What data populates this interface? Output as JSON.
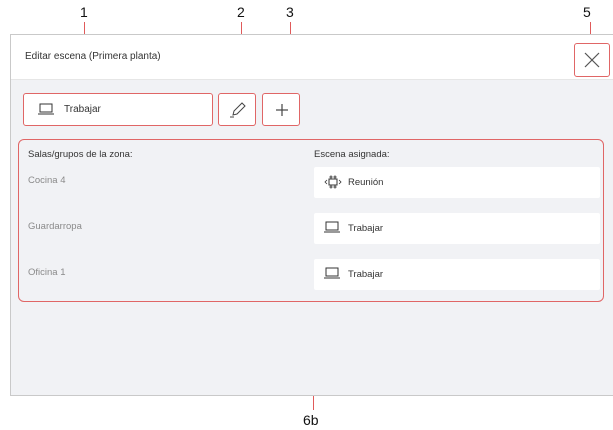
{
  "callouts": {
    "c1": "1",
    "c2": "2",
    "c3": "3",
    "c5": "5",
    "c6b": "6b"
  },
  "dialog": {
    "title": "Editar escena (Primera planta)",
    "close_icon": "close-icon"
  },
  "toolbar": {
    "scene_label": "Trabajar",
    "scene_icon": "laptop-icon",
    "edit_icon": "pencil-icon",
    "add_icon": "plus-icon"
  },
  "zone": {
    "rooms_header": "Salas/grupos de la zona:",
    "scene_header": "Escena asignada:",
    "rows": [
      {
        "room": "Cocina 4",
        "scene": "Reunión",
        "icon": "meeting-icon"
      },
      {
        "room": "Guardarropa",
        "scene": "Trabajar",
        "icon": "laptop-icon"
      },
      {
        "room": "Oficina 1",
        "scene": "Trabajar",
        "icon": "laptop-icon"
      }
    ]
  },
  "colors": {
    "accent": "#e06666",
    "body_bg": "#f1f2f5"
  }
}
